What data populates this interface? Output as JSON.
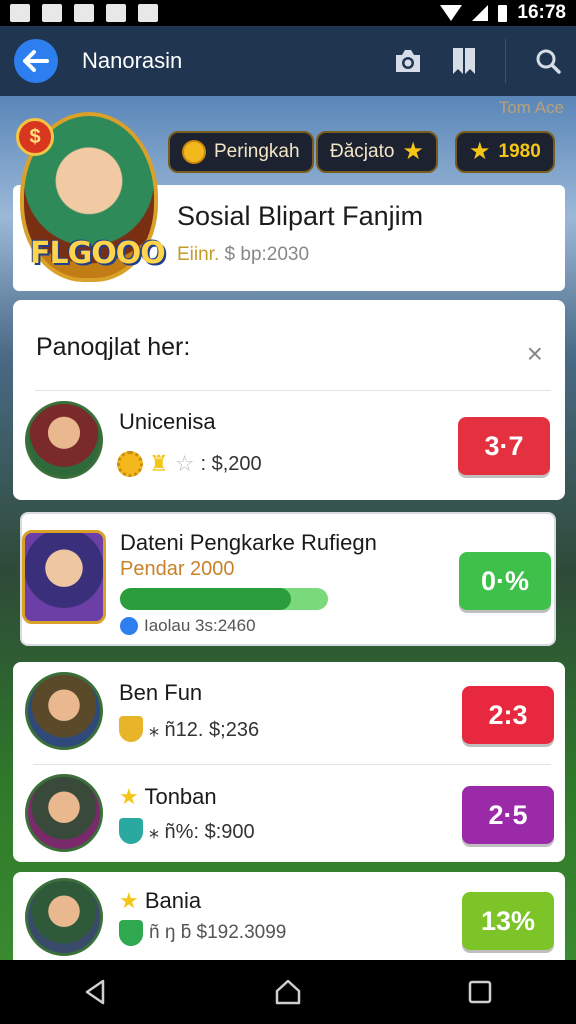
{
  "status_bar": {
    "time": "16:78"
  },
  "app_bar": {
    "title": "Nanorasin"
  },
  "scene_label": "Tom Ace",
  "hero": {
    "coin_symbol": "$",
    "logo_text": "FLGOOO"
  },
  "pills": [
    {
      "label": "Peringkah"
    },
    {
      "label": "Đăcjato"
    },
    {
      "label": "1980"
    }
  ],
  "profile": {
    "name": "Sosial Blipart Fanjim",
    "sub_tag": "Eiinr.",
    "sub_value": "$ bp:2030"
  },
  "panel": {
    "title": "Panoqjlat her:",
    "close": "×"
  },
  "rows": [
    {
      "name": "Unicenisa",
      "meta": ": $,200",
      "score": "3·7",
      "score_color": "#e33140"
    },
    {
      "name": "Dateni Pengkarke Rufiegn",
      "subtitle": "Pendar 2000",
      "progress": 0.82,
      "meta": "Iaolau 3s:2460",
      "score": "0·%",
      "score_color": "#3ec04a"
    },
    {
      "name": "Ben Fun",
      "meta": "⁎ ñ12. $;236",
      "score": "2:3",
      "score_color": "#e8283f"
    },
    {
      "name": "Tonban",
      "meta": "⁎ ñ%: $:900",
      "score": "2·5",
      "score_color": "#9a2aa8"
    },
    {
      "name": "Bania",
      "meta": "ñ ŋ ƃ $192.3099",
      "score": "13%",
      "score_color": "#7cc428"
    }
  ]
}
